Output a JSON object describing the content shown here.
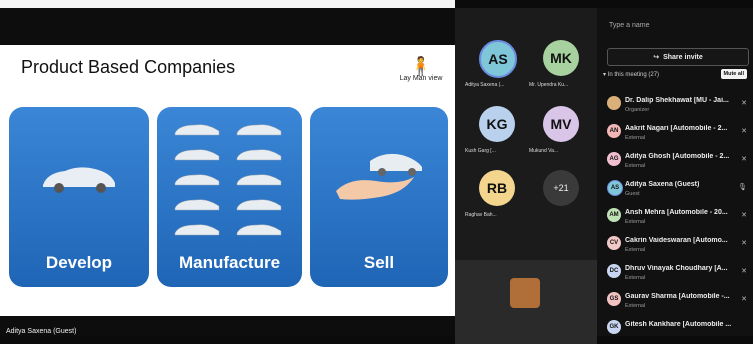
{
  "slide": {
    "title": "Product Based Companies",
    "layman_label": "Lay Man view",
    "tiles": [
      "Develop",
      "Manufacture",
      "Sell"
    ],
    "presenter_name": "Aditya Saxena (Guest)"
  },
  "gallery": {
    "participants": [
      {
        "initials": "AS",
        "name": "Aditya Saxena (...",
        "color": "#7fc6d9"
      },
      {
        "initials": "MK",
        "name": "Mr. Upendra Ku...",
        "color": "#a7d2a0"
      },
      {
        "initials": "KG",
        "name": "Kush Garg [...",
        "color": "#b9d1ec"
      },
      {
        "initials": "MV",
        "name": "Mukund Va...",
        "color": "#d9c5e8"
      },
      {
        "initials": "RB",
        "name": "Raghav Bah...",
        "color": "#f3d58d"
      }
    ],
    "more_count": "+21"
  },
  "panel": {
    "search_placeholder": "Type a name",
    "share_invite": "Share invite",
    "section_label": "In this meeting (27)",
    "mute_all": "Mute all",
    "people": [
      {
        "initials": "",
        "name": "Dr. Dalip Shekhawat [MU - Jai...",
        "role": "Organizer",
        "color": "#d9b07a"
      },
      {
        "initials": "AN",
        "name": "Aakrit Nagari [Automobile - 2...",
        "role": "External",
        "color": "#f1b6b6"
      },
      {
        "initials": "AG",
        "name": "Aditya Ghosh [Automobile - 2...",
        "role": "External",
        "color": "#f0c0d0"
      },
      {
        "initials": "AS",
        "name": "Aditya Saxena (Guest)",
        "role": "Guest",
        "color": "#7fc6d9"
      },
      {
        "initials": "AM",
        "name": "Ansh Mehra [Automobile - 20...",
        "role": "External",
        "color": "#bfe1b6"
      },
      {
        "initials": "CV",
        "name": "Cakrin Vaideswaran [Automo...",
        "role": "External",
        "color": "#f2c7c7"
      },
      {
        "initials": "DC",
        "name": "Dhruv Vinayak Choudhary [A...",
        "role": "External",
        "color": "#c9d6f2"
      },
      {
        "initials": "GS",
        "name": "Gaurav Sharma [Automobile -...",
        "role": "External",
        "color": "#f2c2c2"
      },
      {
        "initials": "GK",
        "name": "Gitesh Kankhare [Automobile ...",
        "role": "",
        "color": "#c9d6f2"
      }
    ]
  }
}
